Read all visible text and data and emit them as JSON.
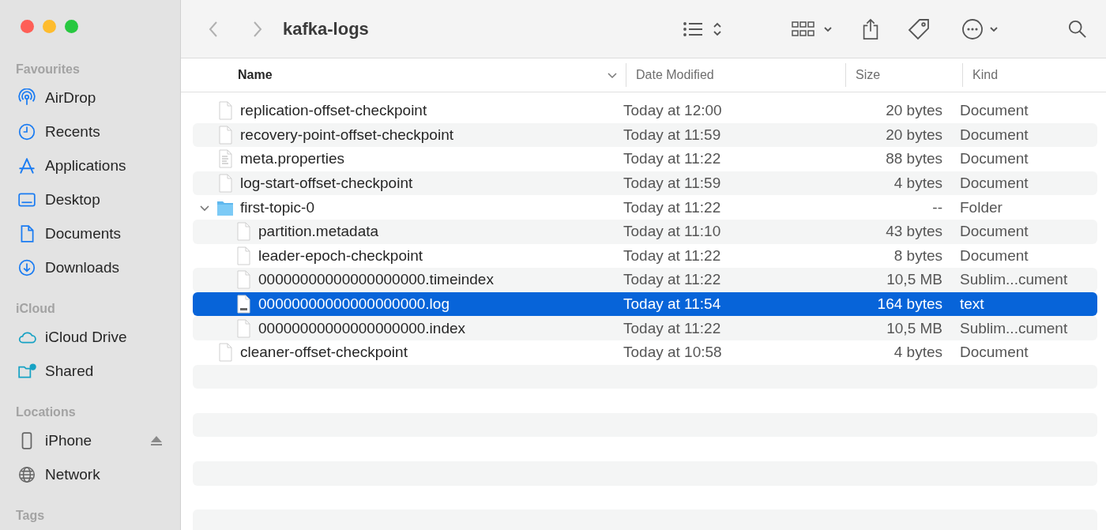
{
  "window": {
    "title": "kafka-logs"
  },
  "sidebar": {
    "sections": [
      {
        "title": "Favourites",
        "items": [
          {
            "label": "AirDrop",
            "selected": false
          },
          {
            "label": "Recents",
            "selected": false
          },
          {
            "label": "Applications",
            "selected": false
          },
          {
            "label": "Desktop",
            "selected": false
          },
          {
            "label": "Documents",
            "selected": false
          },
          {
            "label": "Downloads",
            "selected": false
          }
        ]
      },
      {
        "title": "iCloud",
        "items": [
          {
            "label": "iCloud Drive",
            "selected": false
          },
          {
            "label": "Shared",
            "selected": false
          }
        ]
      },
      {
        "title": "Locations",
        "items": [
          {
            "label": "iPhone",
            "selected": false
          },
          {
            "label": "Network",
            "selected": false
          }
        ]
      },
      {
        "title": "Tags"
      }
    ]
  },
  "table": {
    "columns": [
      {
        "label": "Name",
        "sorted": true
      },
      {
        "label": "Date Modified",
        "sorted": false
      },
      {
        "label": "Size",
        "sorted": false
      },
      {
        "label": "Kind",
        "sorted": false
      }
    ],
    "rows": [
      {
        "kind": "document",
        "name": "replication-offset-checkpoint",
        "date": "Today at 12:00",
        "size": "20 bytes",
        "type": "Document",
        "selected": false
      },
      {
        "kind": "document",
        "name": "recovery-point-offset-checkpoint",
        "date": "Today at 11:59",
        "size": "20 bytes",
        "type": "Document",
        "selected": false
      },
      {
        "kind": "text-document",
        "name": "meta.properties",
        "date": "Today at 11:22",
        "size": "88 bytes",
        "type": "Document",
        "selected": false
      },
      {
        "kind": "document",
        "name": "log-start-offset-checkpoint",
        "date": "Today at 11:59",
        "size": "4 bytes",
        "type": "Document",
        "selected": false
      },
      {
        "kind": "folder",
        "name": "first-topic-0",
        "date": "Today at 11:22",
        "size": "--",
        "type": "Folder",
        "selected": false,
        "expanded": true,
        "children": [
          {
            "kind": "document",
            "name": "partition.metadata",
            "date": "Today at 11:10",
            "size": "43 bytes",
            "type": "Document",
            "selected": false
          },
          {
            "kind": "document",
            "name": "leader-epoch-checkpoint",
            "date": "Today at 11:22",
            "size": "8 bytes",
            "type": "Document",
            "selected": false
          },
          {
            "kind": "document",
            "name": "00000000000000000000.timeindex",
            "date": "Today at 11:22",
            "size": "10,5 MB",
            "type": "Sublim...cument",
            "selected": false
          },
          {
            "kind": "log-document",
            "name": "00000000000000000000.log",
            "date": "Today at 11:54",
            "size": "164 bytes",
            "type": "text",
            "selected": true
          },
          {
            "kind": "document",
            "name": "00000000000000000000.index",
            "date": "Today at 11:22",
            "size": "10,5 MB",
            "type": "Sublim...cument",
            "selected": false
          }
        ]
      },
      {
        "kind": "document",
        "name": "cleaner-offset-checkpoint",
        "date": "Today at 10:58",
        "size": "4 bytes",
        "type": "Document",
        "selected": false
      }
    ]
  }
}
